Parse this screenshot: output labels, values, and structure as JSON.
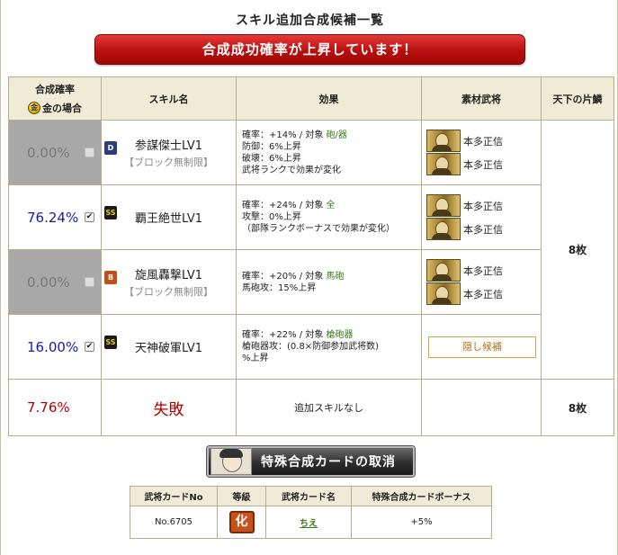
{
  "title": "スキル追加合成候補一覧",
  "banner": "合成成功確率が上昇しています！",
  "headers": {
    "rate": "合成確率",
    "gold": "金の場合",
    "gold_coin": "金",
    "skill": "スキル名",
    "effect": "効果",
    "material": "素材武将",
    "tenka": "天下の片鱗"
  },
  "rows": [
    {
      "rate": "0.00%",
      "checked": false,
      "rank": "D",
      "skill": "参謀傑士LV1",
      "block": "【ブロック無制限】",
      "effect": [
        "確率：+14%",
        "対象",
        "砲/器",
        "防御：6%上昇",
        "破壊：6%上昇",
        "武将ランクで効果が変化"
      ],
      "materials": [
        "本多正信",
        "本多正信"
      ]
    },
    {
      "rate": "76.24%",
      "checked": true,
      "rank": "SS",
      "skill": "覇王絶世LV1",
      "block": "",
      "effect": [
        "確率：+24%",
        "対象",
        "全",
        "攻撃：0%上昇",
        "（部隊ランクボーナスで効果が変化）"
      ],
      "materials": [
        "本多正信",
        "本多正信"
      ]
    },
    {
      "rate": "0.00%",
      "checked": false,
      "rank": "B",
      "skill": "旋風轟撃LV1",
      "block": "【ブロック無制限】",
      "effect": [
        "確率：+20%",
        "対象",
        "馬砲",
        "馬砲攻：15%上昇"
      ],
      "materials": [
        "本多正信",
        "本多正信"
      ]
    },
    {
      "rate": "16.00%",
      "checked": true,
      "rank": "SS",
      "skill": "天神破軍LV1",
      "block": "",
      "effect": [
        "確率：+22%",
        "対象",
        "槍砲器",
        "槍砲器攻：(0.8×防御参加武将数)",
        "%上昇"
      ],
      "hidden_candidate": "隠し候補"
    }
  ],
  "tenka_top": "8枚",
  "fail_row": {
    "rate": "7.76%",
    "label": "失敗",
    "effect": "追加スキルなし",
    "tenka": "8枚"
  },
  "cancel_button": "特殊合成カードの取消",
  "card_table": {
    "headers": [
      "武将カードNo",
      "等級",
      "武将カード名",
      "特殊合成カードボーナス"
    ],
    "no": "No.6705",
    "grade": "化",
    "name": "ちえ",
    "bonus": "+5%"
  },
  "colors": {
    "banner": "#b80f0f",
    "rate_blue": "#1a1aa8",
    "fail_red": "#b00000",
    "target_green": "#3a7a1a",
    "header_bg": "#f0ebd6",
    "disabled_grey": "#a8a8a8"
  }
}
